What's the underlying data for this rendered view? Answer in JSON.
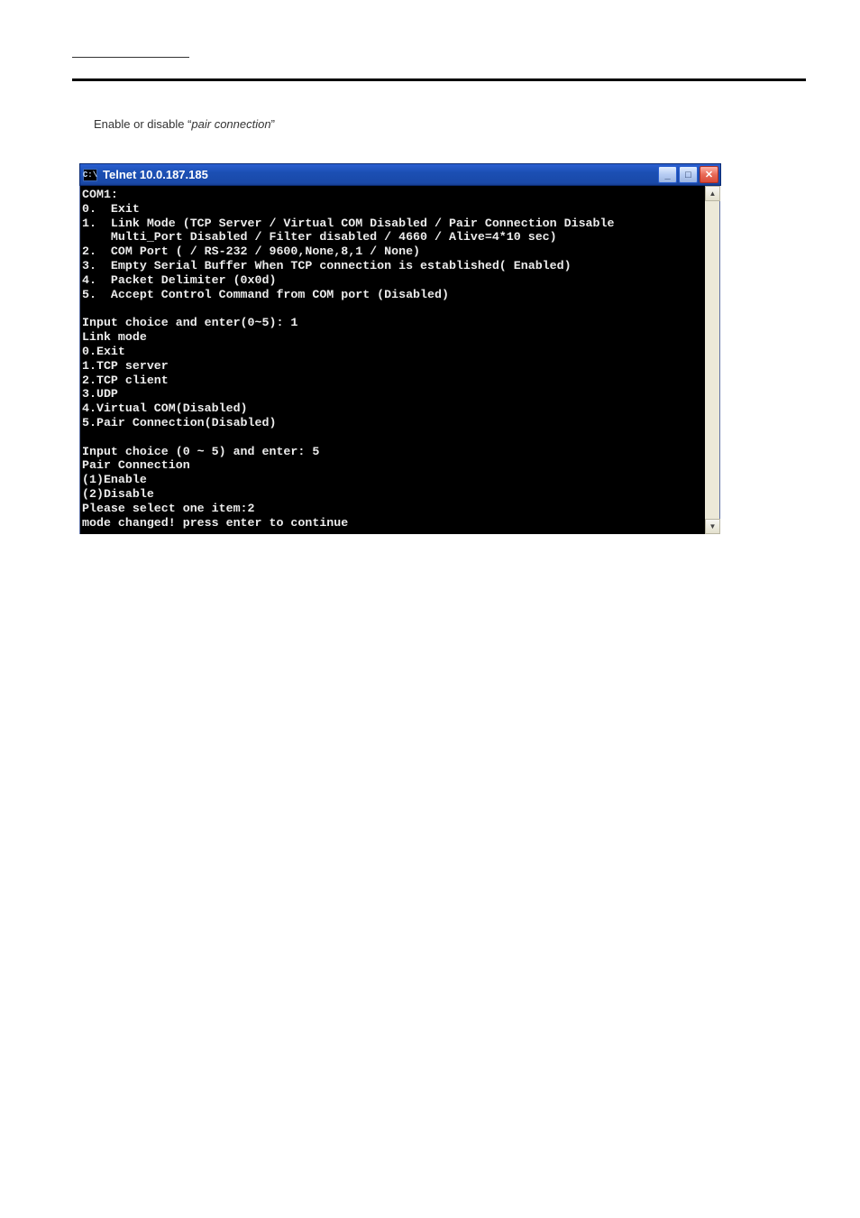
{
  "page": {
    "instruction_prefix": "E",
    "instruction_mid": "nable or disable “",
    "instruction_italic": "pair connection",
    "instruction_suffix": "”"
  },
  "window": {
    "icon_text": "C:\\",
    "title": "Telnet 10.0.187.185",
    "buttons": {
      "minimize": "_",
      "maximize": "□",
      "close": "✕"
    },
    "scroll": {
      "up": "▲",
      "down": "▼"
    }
  },
  "console": {
    "text": "COM1:\n0.  Exit\n1.  Link Mode (TCP Server / Virtual COM Disabled / Pair Connection Disable\n    Multi_Port Disabled / Filter disabled / 4660 / Alive=4*10 sec)\n2.  COM Port ( / RS-232 / 9600,None,8,1 / None)\n3.  Empty Serial Buffer When TCP connection is established( Enabled)\n4.  Packet Delimiter (0x0d)\n5.  Accept Control Command from COM port (Disabled)\n\nInput choice and enter(0~5): 1\nLink mode\n0.Exit\n1.TCP server\n2.TCP client\n3.UDP\n4.Virtual COM(Disabled)\n5.Pair Connection(Disabled)\n\nInput choice (0 ~ 5) and enter: 5\nPair Connection\n(1)Enable\n(2)Disable\nPlease select one item:2\nmode changed! press enter to continue"
  }
}
